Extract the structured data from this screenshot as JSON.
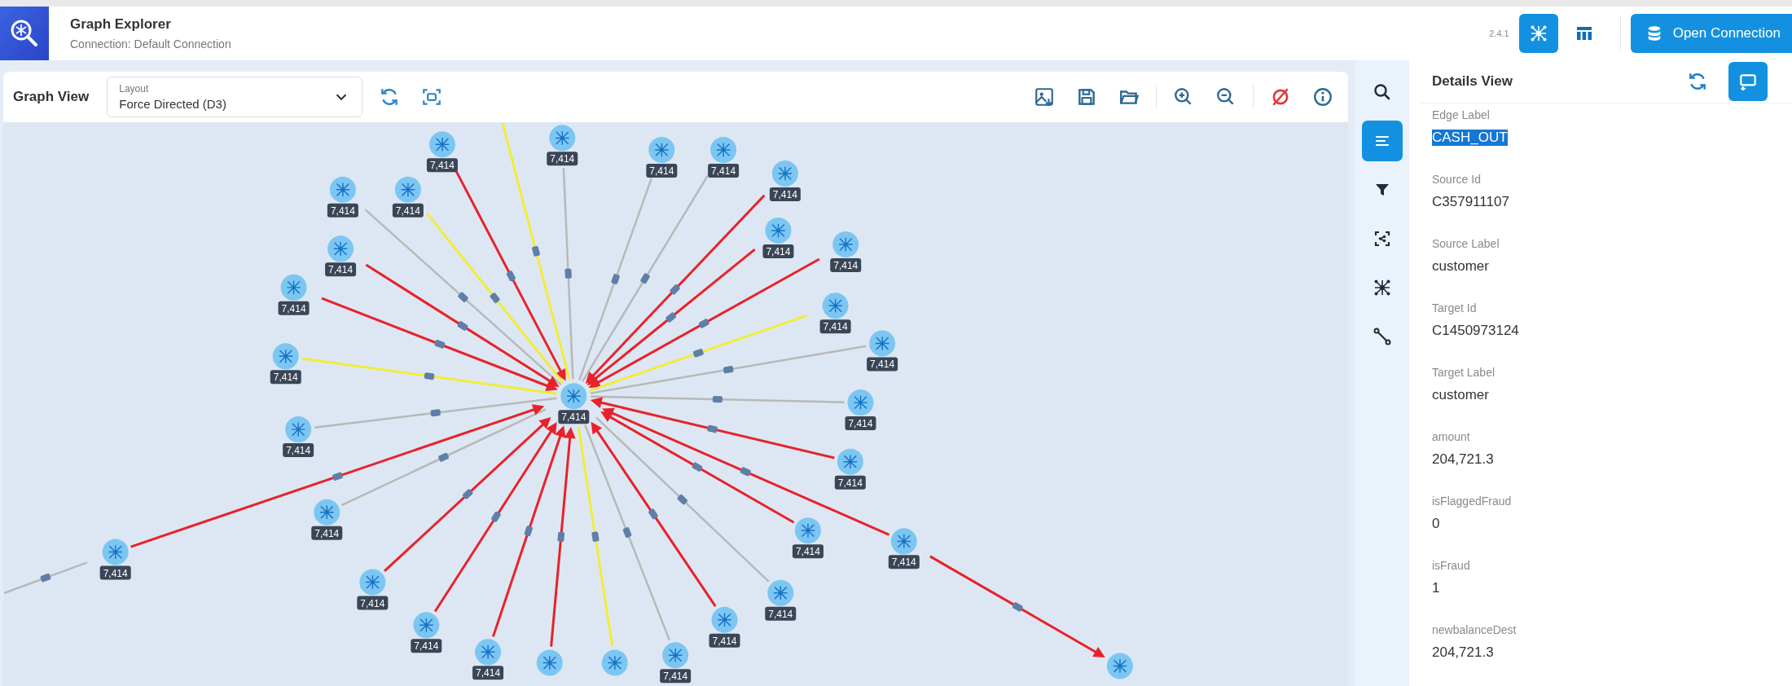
{
  "app": {
    "title": "Graph Explorer",
    "connection": "Connection: Default Connection",
    "version": "2.4.1"
  },
  "view_toggles": [
    {
      "kind": "graph",
      "selected": true
    },
    {
      "kind": "table",
      "selected": false
    }
  ],
  "open_button": "Open Connection",
  "graph_view": {
    "title": "Graph View",
    "layout_label": "Layout",
    "layout_value": "Force Directed (D3)",
    "nodes": [
      {
        "count": "7,414"
      },
      {
        "count": "7,414"
      },
      {
        "count": "7,414"
      },
      {
        "count": "7,414"
      },
      {
        "count": "7,414"
      },
      {
        "count": "7,414"
      },
      {
        "count": "7,414"
      },
      {
        "count": "7,414"
      },
      {
        "count": "7,414"
      },
      {
        "count": "7,414"
      },
      {
        "count": "7,414"
      },
      {
        "count": "7,414"
      },
      {
        "count": "7,414"
      },
      {
        "count": "7,414"
      },
      {
        "count": "7,414"
      },
      {
        "count": "7,414"
      },
      {
        "count": "7,414"
      },
      {
        "count": "7,414"
      },
      {
        "count": "7,414"
      },
      {
        "count": "7,414"
      },
      {
        "count": "7,414"
      },
      {
        "count": "7,414"
      },
      {
        "count": "7,414"
      },
      {
        "count": "7,414"
      },
      {
        "count": "7,414"
      },
      {
        "count": "7,414"
      },
      {
        "count": "7,414"
      },
      {
        "count": "7,414"
      }
    ],
    "edges": [
      {
        "color": "#e8222a"
      },
      {
        "color": "#b8b8b8"
      },
      {
        "color": "#b8b8b8"
      },
      {
        "color": "#b8b8b8"
      },
      {
        "color": "#b8b8b8"
      },
      {
        "color": "#f2ec3a"
      },
      {
        "color": "#e8222a"
      },
      {
        "color": "#e8222a"
      },
      {
        "color": "#e8222a"
      },
      {
        "color": "#e8222a"
      },
      {
        "color": "#e8222a"
      },
      {
        "color": "#f2ec3a"
      },
      {
        "color": "#f2ec3a"
      },
      {
        "color": "#b8b8b8"
      },
      {
        "color": "#b8b8b8"
      },
      {
        "color": "#b8b8b8"
      },
      {
        "color": "#e8222a"
      },
      {
        "color": "#b8b8b8"
      },
      {
        "color": "#e8222a"
      },
      {
        "color": "#e8222a"
      },
      {
        "color": "#e8222a"
      },
      {
        "color": "#e8222a"
      },
      {
        "color": "#b8b8b8"
      },
      {
        "color": "#e8222a"
      },
      {
        "color": "#e8222a"
      },
      {
        "color": "#e8222a"
      },
      {
        "color": "#b8b8b8"
      },
      {
        "color": "#e8222a"
      },
      {
        "color": "#f2ec3a"
      },
      {
        "color": "#e8222a"
      },
      {
        "color": "#b8b8b8"
      },
      {
        "color": "#f2ec3a"
      }
    ]
  },
  "side_tools": [
    {
      "kind": "search",
      "selected": false
    },
    {
      "kind": "details",
      "selected": true
    },
    {
      "kind": "filter",
      "selected": false
    },
    {
      "kind": "focus",
      "selected": false
    },
    {
      "kind": "graph",
      "selected": false
    },
    {
      "kind": "path",
      "selected": false
    }
  ],
  "details_view": {
    "title": "Details View",
    "fields": [
      {
        "label": "Edge Label",
        "value": "CASH_OUT",
        "highlighted": true
      },
      {
        "label": "Source Id",
        "value": "C357911107",
        "highlighted": false
      },
      {
        "label": "Source Label",
        "value": "customer",
        "highlighted": false
      },
      {
        "label": "Target Id",
        "value": "C1450973124",
        "highlighted": false
      },
      {
        "label": "Target Label",
        "value": "customer",
        "highlighted": false
      },
      {
        "label": "amount",
        "value": "204,721.3",
        "highlighted": false
      },
      {
        "label": "isFlaggedFraud",
        "value": "0",
        "highlighted": false
      },
      {
        "label": "isFraud",
        "value": "1",
        "highlighted": false
      },
      {
        "label": "newbalanceDest",
        "value": "204,721.3",
        "highlighted": false
      }
    ]
  }
}
